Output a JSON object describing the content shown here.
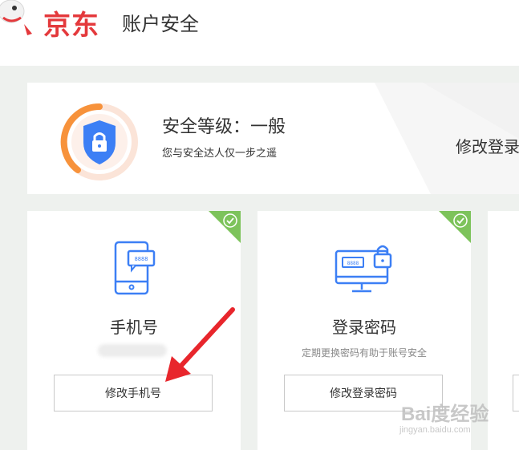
{
  "header": {
    "logo_text": "京东",
    "page_title": "账户安全"
  },
  "security_level": {
    "title": "安全等级：一般",
    "subtitle": "您与安全达人仅一步之遥",
    "modify_link": "修改登录"
  },
  "cards": [
    {
      "title": "手机号",
      "value_masked": "",
      "button": "修改手机号",
      "verified": true,
      "icon": "phone-icon"
    },
    {
      "title": "登录密码",
      "description": "定期更换密码有助于账号安全",
      "button": "修改登录密码",
      "verified": true,
      "icon": "computer-lock-icon"
    }
  ],
  "watermark": {
    "main": "Bai度经验",
    "sub": "jingyan.baidu.com"
  },
  "colors": {
    "brand_red": "#e4393c",
    "verified_green": "#7dc35b",
    "icon_blue": "#3c7ff5",
    "arrow_red": "#e8262c"
  }
}
